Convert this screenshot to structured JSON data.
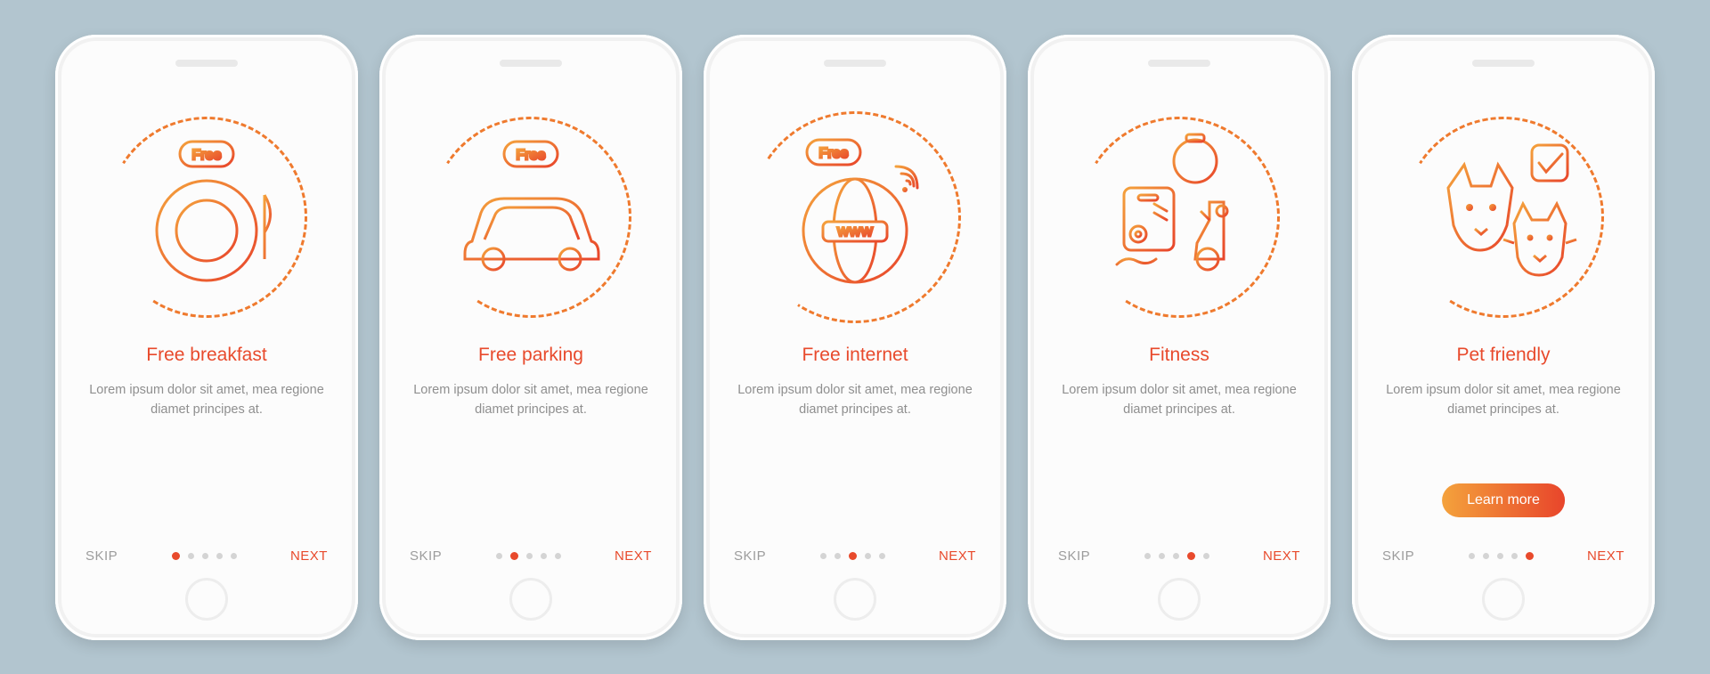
{
  "screens": [
    {
      "title": "Free breakfast",
      "desc": "Lorem ipsum dolor sit amet, mea regione diamet principes at.",
      "skip": "SKIP",
      "next": "NEXT",
      "active": 0,
      "cta": null
    },
    {
      "title": "Free parking",
      "desc": "Lorem ipsum dolor sit amet, mea regione diamet principes at.",
      "skip": "SKIP",
      "next": "NEXT",
      "active": 1,
      "cta": null
    },
    {
      "title": "Free internet",
      "desc": "Lorem ipsum dolor sit amet, mea regione diamet principes at.",
      "skip": "SKIP",
      "next": "NEXT",
      "active": 2,
      "cta": null
    },
    {
      "title": "Fitness",
      "desc": "Lorem ipsum dolor sit amet, mea regione diamet principes at.",
      "skip": "SKIP",
      "next": "NEXT",
      "active": 3,
      "cta": null
    },
    {
      "title": "Pet friendly",
      "desc": "Lorem ipsum dolor sit amet, mea regione diamet principes at.",
      "skip": "SKIP",
      "next": "NEXT",
      "active": 4,
      "cta": "Learn more"
    }
  ],
  "badge": {
    "free": "Free",
    "www": "WWW"
  },
  "colors": {
    "accent": "#e84a2c",
    "stroke_a": "#f4a23c",
    "stroke_b": "#e8452b"
  }
}
